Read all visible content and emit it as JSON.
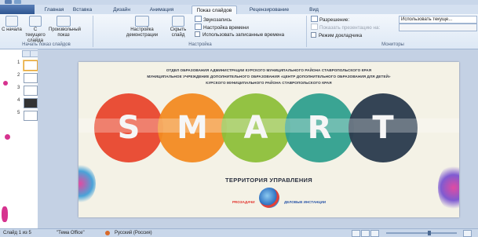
{
  "tabs": [
    {
      "label": "Главная",
      "active": false
    },
    {
      "label": "Вставка",
      "active": false
    },
    {
      "label": "Дизайн",
      "active": false
    },
    {
      "label": "Анимация",
      "active": false
    },
    {
      "label": "Показ слайдов",
      "active": true
    },
    {
      "label": "Рецензирование",
      "active": false
    },
    {
      "label": "Вид",
      "active": false
    }
  ],
  "ribbon": {
    "start_group": {
      "from_beginning": "С начала",
      "from_current": "С текущего слайда",
      "custom_show": "Произвольный показ",
      "label": "Начать показ слайдов"
    },
    "setup_group": {
      "setup_show": "Настройка демонстрации",
      "hide_slide": "Скрыть слайд",
      "record_narration": "Звукозапись",
      "rehearse_timings": "Настройка времени",
      "use_timings": "Использовать записанные времена",
      "label": "Настройка"
    },
    "monitors_group": {
      "resolution_label": "Разрешение:",
      "resolution_value": "Использовать текуще...",
      "show_on_label": "Показать презентацию на:",
      "presenter_view": "Режим докладчика",
      "label": "Мониторы"
    }
  },
  "slides_pane": {
    "thumbnails": [
      "1",
      "2",
      "3",
      "4",
      "5"
    ],
    "selected": 1
  },
  "slide": {
    "header_lines": [
      "ОТДЕЛ ОБРАЗОВАНИЯ АДМИНИСТРАЦИИ КУРСКОГО МУНИЦИПАЛЬНОГО РАЙОНА СТАВРОПОЛЬСКОГО КРАЯ",
      "МУНИЦИПАЛЬНОЕ УЧРЕЖДЕНИЕ ДОПОЛНИТЕЛЬНОГО ОБРАЗОВАНИЯ «ЦЕНТР ДОПОЛНИТЕЛЬНОГО ОБРАЗОВАНИЯ ДЛЯ ДЕТЕЙ»",
      "КУРСКОГО МУНИЦИПАЛЬНОГО РАЙОНА СТАВРОПОЛЬСКОГО КРАЯ"
    ],
    "smart_letters": [
      {
        "char": "S",
        "color": "#e8462d"
      },
      {
        "char": "M",
        "color": "#f28a22"
      },
      {
        "char": "A",
        "color": "#8dbf3a"
      },
      {
        "char": "R",
        "color": "#2f9f8e"
      },
      {
        "char": "T",
        "color": "#2d3e50"
      }
    ],
    "subtitle": "ТЕРРИТОРИЯ УПРАВЛЕНИЯ",
    "logo_left": "PROЗАДАЧИ",
    "logo_right": "ДЕЛОВЫЕ ИНСТАНЦИИ"
  },
  "statusbar": {
    "slide_info": "Слайд 1 из 5",
    "theme": "\"Тема Office\"",
    "language": "Русский (Россия)"
  },
  "colors": {
    "ribbon_bg": "#dde8f5",
    "tab_bar": "#d4e0f0",
    "accent_orange": "#e4a43a"
  }
}
